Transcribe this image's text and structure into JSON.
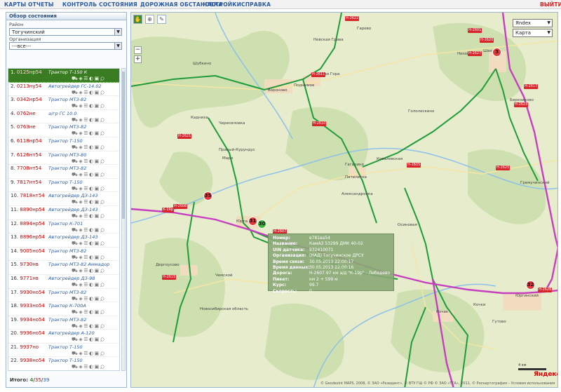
{
  "nav": {
    "items": [
      "КАРТЫ",
      "ОТЧЕТЫ",
      "КОНТРОЛЬ СОСТОЯНИЯ",
      "ДОРОЖНАЯ ОБСТАНОВКА",
      "НАСТРОЙКИ",
      "СПРАВКА"
    ],
    "exit": "ВЫЙТИ"
  },
  "sidebar": {
    "title": "Обзор состояния",
    "district_label": "Район",
    "district_value": "Тогучинский",
    "org_label": "Организация",
    "org_value": "---все---",
    "vehicles": [
      {
        "n": "1.",
        "plate": "0125нр54",
        "model": "Трактор Т-150 К"
      },
      {
        "n": "2.",
        "plate": "0213ну54",
        "model": "Автогрейдер ГС-14.02"
      },
      {
        "n": "3.",
        "plate": "0342нр54",
        "model": "Трактор МТЗ-82"
      },
      {
        "n": "4.",
        "plate": "0762не",
        "model": "а/гр ГС 10.0"
      },
      {
        "n": "5.",
        "plate": "0763не",
        "model": "Трактор МТЗ-82"
      },
      {
        "n": "6.",
        "plate": "6118нр54",
        "model": "Трактор Т-150"
      },
      {
        "n": "7.",
        "plate": "6126нт54",
        "model": "Трактор МТЗ-80"
      },
      {
        "n": "8.",
        "plate": "7708нт54",
        "model": "Трактор МТЗ-82"
      },
      {
        "n": "9.",
        "plate": "7817нт54",
        "model": "Трактор Т-150"
      },
      {
        "n": "10.",
        "plate": "7818нт54",
        "model": "Автогрейдер ДЗ-143"
      },
      {
        "n": "11.",
        "plate": "8890нр54",
        "model": "Автогрейдер ДЗ-143"
      },
      {
        "n": "12.",
        "plate": "8894нр54",
        "model": "Трактор К-701"
      },
      {
        "n": "13.",
        "plate": "8896нр54",
        "model": "Автогрейдер ДЗ-143"
      },
      {
        "n": "14.",
        "plate": "9005но54",
        "model": "Трактор МТЗ-82"
      },
      {
        "n": "15.",
        "plate": "9730нв",
        "model": "Трактор МТЗ-82 Аммадор"
      },
      {
        "n": "16.",
        "plate": "9771нв",
        "model": "Автогрейдер ДЗ-98"
      },
      {
        "n": "17.",
        "plate": "9930но54",
        "model": "Трактор МТЗ-82"
      },
      {
        "n": "18.",
        "plate": "9933но54",
        "model": "Трактор К-700А"
      },
      {
        "n": "19.",
        "plate": "9934но54",
        "model": "Трактор МТЗ-82"
      },
      {
        "n": "20.",
        "plate": "9936но54",
        "model": "Автогрейдер А-120"
      },
      {
        "n": "21.",
        "plate": "9937но",
        "model": "Трактор Т-150"
      },
      {
        "n": "22.",
        "plate": "9938но54",
        "model": "Трактор Т-150"
      }
    ],
    "itogo_label": "Итого:",
    "itogo_active": "4",
    "itogo_sep1": "/",
    "itogo_inactive": "35",
    "itogo_sep2": "/",
    "itogo_total": "39"
  },
  "map": {
    "provider": "Яndex",
    "maptype": "Карта",
    "labels": [
      "Шубкино",
      "Кадниха",
      "Правый-Курундус",
      "Пятилетка",
      "Гагарино",
      "Гололескино",
      "Невская Грива",
      "Мари",
      "Дергоусово",
      "Чемской",
      "Новосибирская область",
      "Кочак",
      "Кочки",
      "Березиково",
      "Гремучинский",
      "Юргинский",
      "Шахта",
      "Низовка",
      "Вороново",
      "Поднимое",
      "Ковалевская",
      "Гарево",
      "Ясная Гора",
      "Юрта",
      "Осиновая",
      "Александровка",
      "Чересиловка",
      "Гутово"
    ],
    "road_signs": [
      "Н-2621",
      "Н-2610",
      "Н-2611",
      "Н-2608",
      "Н-2607",
      "К-19р",
      "Н-2605",
      "Н-2601",
      "Н-2615",
      "Н-2620",
      "Н-2623",
      "Н-2625",
      "Н-2617",
      "Н-2626",
      "Н-2622",
      "Н-2627"
    ],
    "markers": [
      {
        "label": "35",
        "color": "red"
      },
      {
        "label": "31",
        "color": "red"
      },
      {
        "label": "30",
        "color": "green"
      },
      {
        "label": "32",
        "color": "red"
      },
      {
        "label": "3",
        "color": "red"
      }
    ],
    "popup": {
      "rows": [
        {
          "k": "Номер:",
          "v": "в781ва54"
        },
        {
          "k": "Название:",
          "v": "КамАЗ 53299 ДМК 40-02"
        },
        {
          "k": "UIN датчика:",
          "v": "932410071"
        },
        {
          "k": "Организация:",
          "v": "(НАД) Тогучинское ДРСУ"
        },
        {
          "k": "Время связи:",
          "v": "30.05.2013 22:00:17"
        },
        {
          "k": "Время данных:",
          "v": "30.05.2013 22:00:16"
        },
        {
          "k": "Дорога:",
          "v": "Н-2607.97 км а/д \"К-19р\" - Лебедево"
        },
        {
          "k": "Пикет:",
          "v": "км 2 + 599 м"
        },
        {
          "k": "Курс:",
          "v": "99.7"
        },
        {
          "k": "Скорость:",
          "v": "0"
        }
      ]
    },
    "scale_label": "4 км",
    "logo": "Яндекс",
    "copyright": "© Geodezint MAPS, 2008, © ЗАО «Резидент», © ВТУ ГШ © РФ © ЗАО «ТГА», 2011, © Роскартография – Условия использования"
  }
}
